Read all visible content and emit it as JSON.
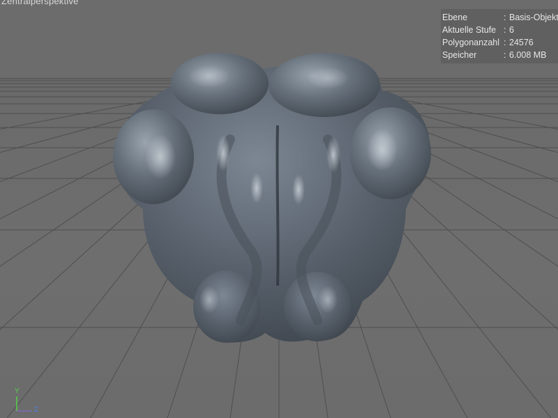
{
  "viewport": {
    "camera_label": "Zentralperspektive",
    "background_color": "#6b6b6b",
    "grid_color": "#4e4e4e",
    "object_color": "#5c6570"
  },
  "hud": {
    "rows": [
      {
        "key": "Ebene",
        "sep": ":",
        "value": "Basis-Objekt"
      },
      {
        "key": "Aktuelle Stufe",
        "sep": ":",
        "value": "6"
      },
      {
        "key": "Polygonanzahl",
        "sep": ":",
        "value": "24576"
      },
      {
        "key": "Speicher",
        "sep": ":",
        "value": "6.008 MB"
      }
    ]
  },
  "axis_gizmo": {
    "y_label": "Y",
    "z_label": "Z",
    "y_color": "#56d24a",
    "z_color": "#4d7ee6",
    "x_color": "#e04040"
  }
}
